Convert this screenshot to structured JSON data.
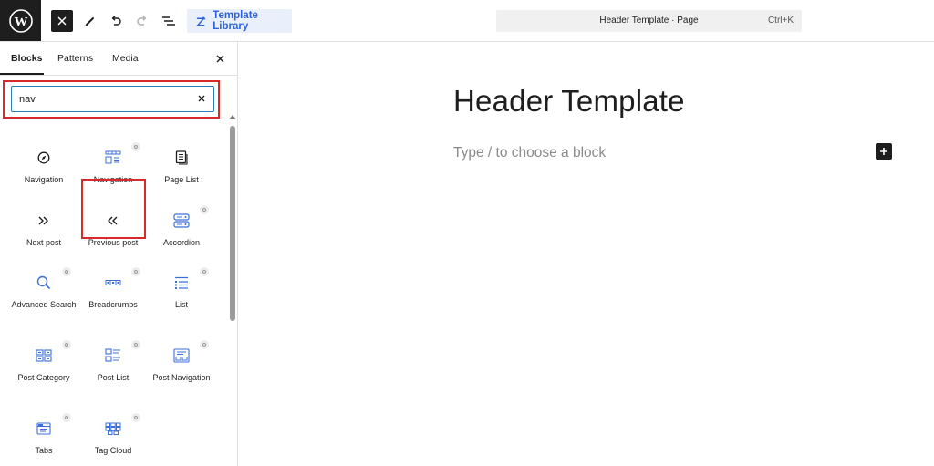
{
  "topbar": {
    "template_library_label": "Template Library",
    "command_title": "Header Template · Page",
    "command_shortcut": "Ctrl+K"
  },
  "inserter": {
    "tabs": [
      {
        "label": "Blocks",
        "active": true
      },
      {
        "label": "Patterns",
        "active": false
      },
      {
        "label": "Media",
        "active": false
      }
    ],
    "search": {
      "value": "nav"
    },
    "blocks": [
      {
        "label": "Navigation",
        "icon": "compass-icon"
      },
      {
        "label": "Navigation",
        "icon": "navigation-grid-icon"
      },
      {
        "label": "Page List",
        "icon": "page-list-icon"
      },
      {
        "label": "Next post",
        "icon": "double-chevron-right-icon"
      },
      {
        "label": "Previous post",
        "icon": "double-chevron-left-icon"
      },
      {
        "label": "Accordion",
        "icon": "accordion-icon"
      },
      {
        "label": "Advanced Search",
        "icon": "search-icon"
      },
      {
        "label": "Breadcrumbs",
        "icon": "breadcrumbs-icon"
      },
      {
        "label": "List",
        "icon": "list-icon"
      },
      {
        "label": "Post Category",
        "icon": "post-category-icon"
      },
      {
        "label": "Post List",
        "icon": "post-list-icon"
      },
      {
        "label": "Post Navigation",
        "icon": "post-navigation-icon"
      },
      {
        "label": "Tabs",
        "icon": "tabs-icon"
      },
      {
        "label": "Tag Cloud",
        "icon": "tag-cloud-icon"
      }
    ]
  },
  "editor": {
    "title": "Header Template",
    "placeholder": "Type / to choose a block"
  },
  "colors": {
    "accent": "#2e63d6",
    "highlight": "#d82a2a",
    "dark": "#1e1e1e"
  }
}
